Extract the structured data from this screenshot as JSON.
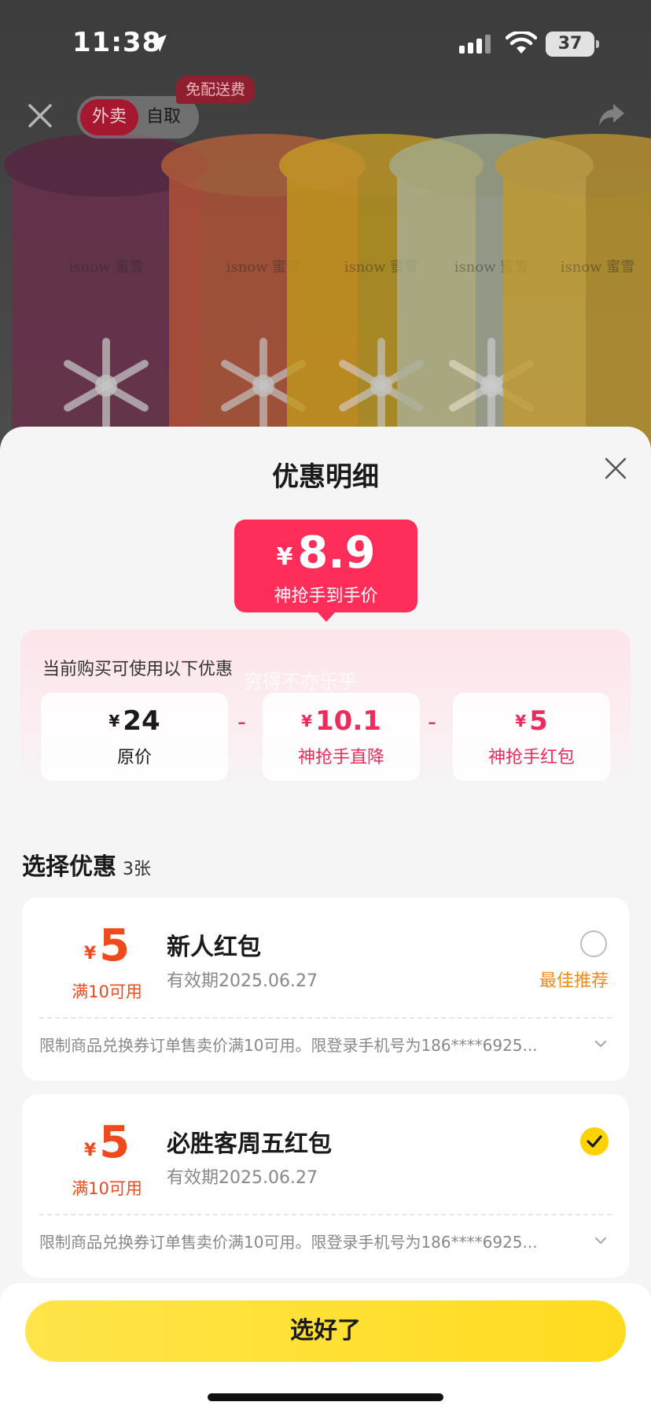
{
  "status_bar": {
    "time": "11:38",
    "battery": "37"
  },
  "top_nav": {
    "tab_delivery": "外卖",
    "tab_pickup": "自取",
    "free_delivery_badge": "免配送费"
  },
  "product_image": {
    "brand_text": "isnow 蜜雪"
  },
  "sheet": {
    "title": "优惠明细",
    "final_price": {
      "currency": "¥",
      "amount": "8.9",
      "label": "神抢手到手价"
    },
    "breakdown": {
      "hint": "当前购买可使用以下优惠",
      "watermark": "穷得不亦乐乎",
      "items": [
        {
          "currency": "¥",
          "amount": "24",
          "label": "原价"
        },
        {
          "currency": "¥",
          "amount": "10.1",
          "label": "神抢手直降"
        },
        {
          "currency": "¥",
          "amount": "5",
          "label": "神抢手红包"
        }
      ],
      "operator": "-"
    },
    "select_section": {
      "title": "选择优惠",
      "count": "3张"
    },
    "coupons": [
      {
        "currency": "¥",
        "amount": "5",
        "condition": "满10可用",
        "name": "新人红包",
        "expiry": "有效期2025.06.27",
        "selected": false,
        "tag": "最佳推荐",
        "description": "限制商品兑换券订单售卖价满10可用。限登录手机号为186****6925..."
      },
      {
        "currency": "¥",
        "amount": "5",
        "condition": "满10可用",
        "name": "必胜客周五红包",
        "expiry": "有效期2025.06.27",
        "selected": true,
        "tag": "",
        "description": "限制商品兑换券订单售卖价满10可用。限登录手机号为186****6925..."
      }
    ],
    "confirm_label": "选好了"
  },
  "colors": {
    "accent_pink": "#ff2d5a",
    "coupon_orange": "#f04a1c",
    "confirm_yellow": "#ffdb1f"
  }
}
